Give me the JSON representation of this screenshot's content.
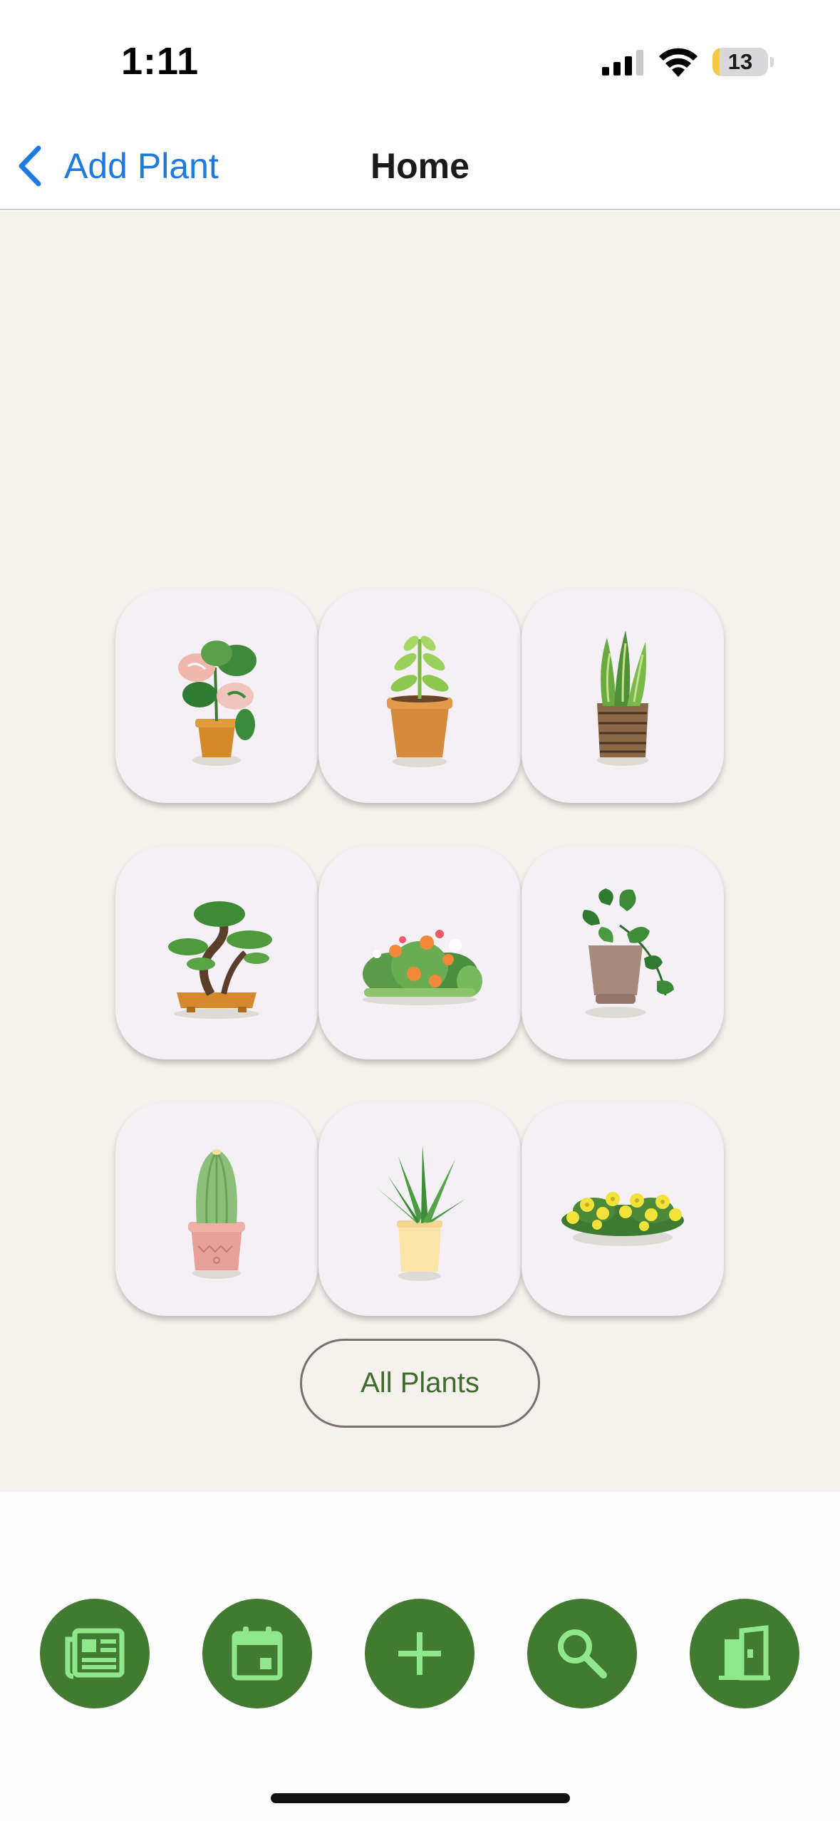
{
  "status_bar": {
    "time": "1:11",
    "battery": "13",
    "battery_level": 0.13
  },
  "nav": {
    "back_label": "Add Plant",
    "title": "Home"
  },
  "plants": [
    {
      "icon": "variegated-plant-icon"
    },
    {
      "icon": "seedling-pot-icon"
    },
    {
      "icon": "snake-plant-icon"
    },
    {
      "icon": "bonsai-tree-icon"
    },
    {
      "icon": "wildflower-bush-icon"
    },
    {
      "icon": "pothos-plant-icon"
    },
    {
      "icon": "cactus-icon"
    },
    {
      "icon": "aloe-plant-icon"
    },
    {
      "icon": "yellow-flower-bed-icon"
    }
  ],
  "all_plants_label": "All Plants",
  "tab_bar": [
    {
      "icon": "news-icon"
    },
    {
      "icon": "calendar-icon"
    },
    {
      "icon": "plus-icon"
    },
    {
      "icon": "search-icon"
    },
    {
      "icon": "door-icon"
    }
  ],
  "colors": {
    "accent_blue": "#1f7ae0",
    "background": "#f5f1ec",
    "card": "#f4f0f6",
    "tab_green": "#437a31",
    "tab_icon_green": "#8fe98c",
    "label_green": "#3f6b2c"
  }
}
